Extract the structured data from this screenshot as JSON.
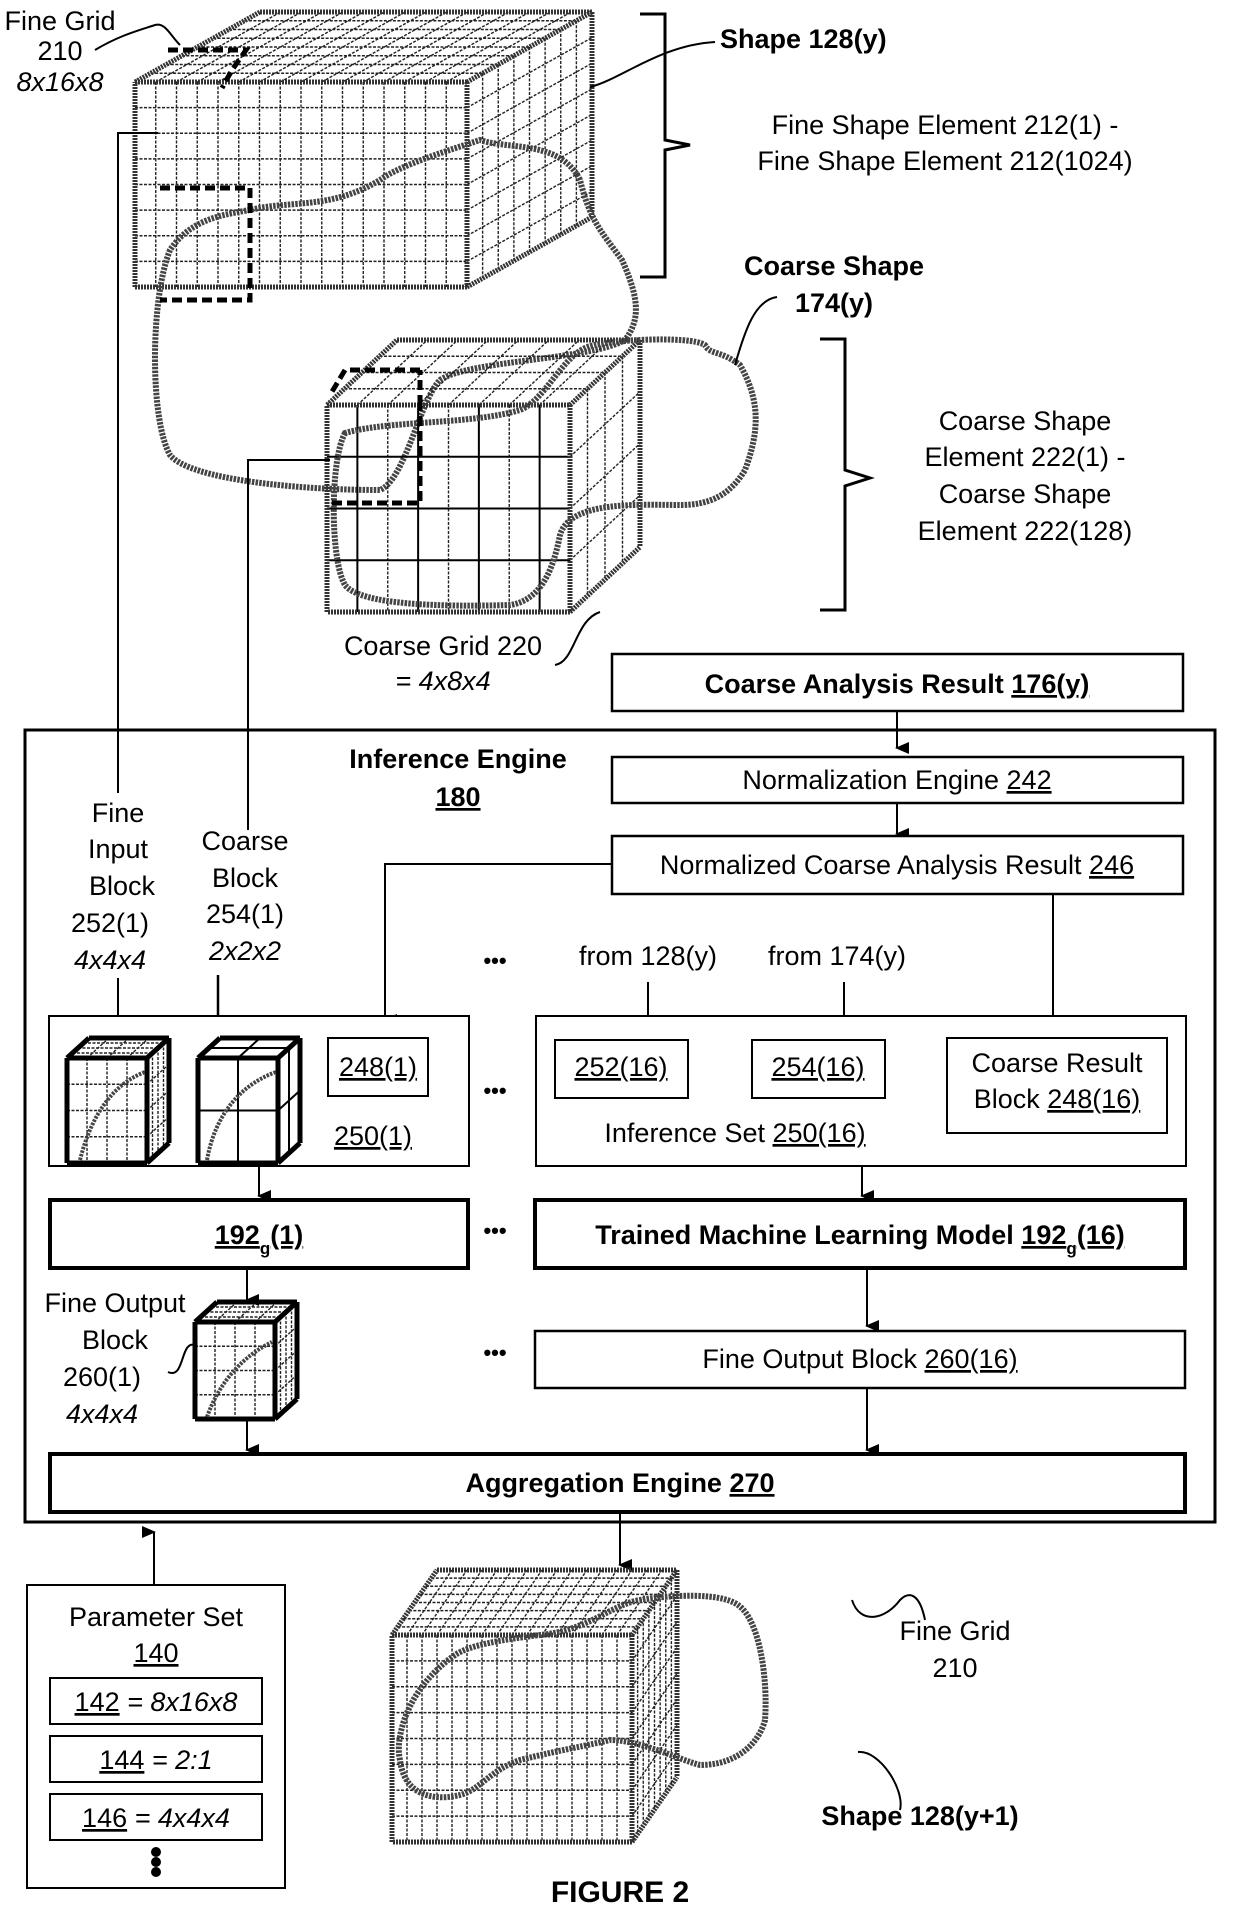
{
  "figure": {
    "caption": "FIGURE 2"
  },
  "fine_grid_top": {
    "label_line1": "Fine Grid",
    "label_line2": "210",
    "dims": "8x16x8",
    "shape_label": "Shape 128(y)",
    "elements_line1": "Fine Shape Element 212(1) -",
    "elements_line2": "Fine Shape Element 212(1024)",
    "cols": 16,
    "rows": 8,
    "depth": 8
  },
  "coarse_grid": {
    "shape_label_line1": "Coarse Shape",
    "shape_label_line2": "174(y)",
    "elements_line1": "Coarse Shape",
    "elements_line2": "Element 222(1) -",
    "elements_line3": "Coarse Shape",
    "elements_line4": "Element 222(128)",
    "grid_label_line1": "Coarse Grid 220",
    "grid_label_line2": "= 4x8x4",
    "cols": 8,
    "rows": 4,
    "depth": 4
  },
  "coarse_analysis_result": {
    "text": "Coarse Analysis Result ",
    "ref": "176(y)"
  },
  "inference_engine": {
    "title": "Inference Engine",
    "ref": "180",
    "normalization_engine": {
      "text": "Normalization Engine ",
      "ref": "242"
    },
    "normalized_result": {
      "text": "Normalized Coarse Analysis Result ",
      "ref": "246"
    },
    "fine_input_block": {
      "line1": "Fine",
      "line2": "Input",
      "line3": "Block",
      "line4": "252(1)",
      "dims": "4x4x4"
    },
    "coarse_block": {
      "line1": "Coarse",
      "line2": "Block",
      "line3": "254(1)",
      "dims": "2x2x2"
    },
    "set_1": {
      "coarse_result_ref": "248(1)",
      "set_ref": "250(1)"
    },
    "ellipsis": "•••",
    "from_fine": "from 128(y)",
    "from_coarse": "from 174(y)",
    "set_16": {
      "fine_ref": "252(16)",
      "coarse_ref": "254(16)",
      "coarse_result_line1": "Coarse Result",
      "coarse_result_line2_text": "Block ",
      "coarse_result_ref": "248(16)",
      "set_text": "Inference Set ",
      "set_ref": "250(16)"
    },
    "model_1": {
      "ref_base": "192",
      "ref_sub": "g",
      "ref_suffix": "(1)"
    },
    "model_16": {
      "text": "Trained Machine Learning Model ",
      "ref_base": "192",
      "ref_sub": "g",
      "ref_suffix": "(16)"
    },
    "fine_output_1": {
      "line1": "Fine Output",
      "line2": "Block",
      "line3": "260(1)",
      "dims": "4x4x4"
    },
    "fine_output_16": {
      "text": "Fine Output Block ",
      "ref": "260(16)"
    },
    "aggregation": {
      "text": "Aggregation Engine ",
      "ref": "270"
    }
  },
  "parameter_set": {
    "title": "Parameter Set",
    "ref": "140",
    "items": [
      {
        "ref": "142",
        "value": " = 8x16x8"
      },
      {
        "ref": "144",
        "value": " = 2:1"
      },
      {
        "ref": "146",
        "value": " = 4x4x4"
      }
    ]
  },
  "fine_grid_bottom": {
    "label_line1": "Fine Grid",
    "label_line2": "210",
    "shape_label": "Shape 128(y+1)"
  }
}
